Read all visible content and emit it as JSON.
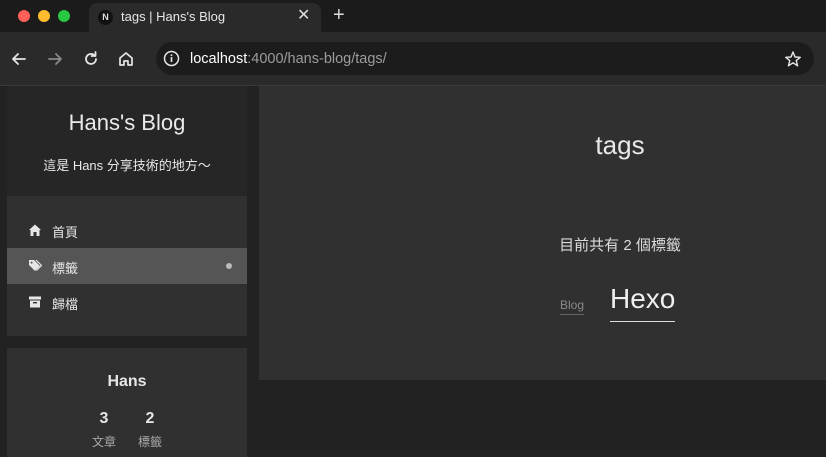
{
  "browser": {
    "tab": {
      "favicon_letter": "N",
      "title": "tags | Hans's Blog",
      "close": "✕"
    },
    "new_tab": "+",
    "url": {
      "host": "localhost",
      "path": ":4000/hans-blog/tags/"
    }
  },
  "sidebar": {
    "brand": {
      "title": "Hans's Blog",
      "subtitle": "這是 Hans 分享技術的地方～"
    },
    "menu": [
      {
        "label": "首頁",
        "icon": "home-icon"
      },
      {
        "label": "標籤",
        "icon": "tags-icon",
        "active": true
      },
      {
        "label": "歸檔",
        "icon": "archive-icon"
      }
    ],
    "author": {
      "name": "Hans",
      "stats": [
        {
          "count": "3",
          "label": "文章"
        },
        {
          "count": "2",
          "label": "標籤"
        }
      ]
    }
  },
  "main": {
    "title": "tags",
    "count_text": "目前共有 2 個標籤",
    "tags": [
      {
        "name": "Blog"
      },
      {
        "name": "Hexo"
      }
    ]
  },
  "colors": {
    "accent_active": "#555555",
    "card": "#303030",
    "background": "#222222"
  }
}
